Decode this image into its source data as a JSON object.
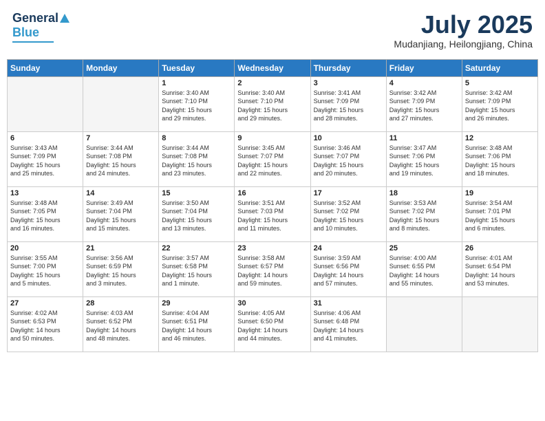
{
  "header": {
    "logo_general": "General",
    "logo_blue": "Blue",
    "month_year": "July 2025",
    "location": "Mudanjiang, Heilongjiang, China"
  },
  "days_of_week": [
    "Sunday",
    "Monday",
    "Tuesday",
    "Wednesday",
    "Thursday",
    "Friday",
    "Saturday"
  ],
  "weeks": [
    [
      {
        "day": "",
        "info": ""
      },
      {
        "day": "",
        "info": ""
      },
      {
        "day": "1",
        "info": "Sunrise: 3:40 AM\nSunset: 7:10 PM\nDaylight: 15 hours\nand 29 minutes."
      },
      {
        "day": "2",
        "info": "Sunrise: 3:40 AM\nSunset: 7:10 PM\nDaylight: 15 hours\nand 29 minutes."
      },
      {
        "day": "3",
        "info": "Sunrise: 3:41 AM\nSunset: 7:09 PM\nDaylight: 15 hours\nand 28 minutes."
      },
      {
        "day": "4",
        "info": "Sunrise: 3:42 AM\nSunset: 7:09 PM\nDaylight: 15 hours\nand 27 minutes."
      },
      {
        "day": "5",
        "info": "Sunrise: 3:42 AM\nSunset: 7:09 PM\nDaylight: 15 hours\nand 26 minutes."
      }
    ],
    [
      {
        "day": "6",
        "info": "Sunrise: 3:43 AM\nSunset: 7:09 PM\nDaylight: 15 hours\nand 25 minutes."
      },
      {
        "day": "7",
        "info": "Sunrise: 3:44 AM\nSunset: 7:08 PM\nDaylight: 15 hours\nand 24 minutes."
      },
      {
        "day": "8",
        "info": "Sunrise: 3:44 AM\nSunset: 7:08 PM\nDaylight: 15 hours\nand 23 minutes."
      },
      {
        "day": "9",
        "info": "Sunrise: 3:45 AM\nSunset: 7:07 PM\nDaylight: 15 hours\nand 22 minutes."
      },
      {
        "day": "10",
        "info": "Sunrise: 3:46 AM\nSunset: 7:07 PM\nDaylight: 15 hours\nand 20 minutes."
      },
      {
        "day": "11",
        "info": "Sunrise: 3:47 AM\nSunset: 7:06 PM\nDaylight: 15 hours\nand 19 minutes."
      },
      {
        "day": "12",
        "info": "Sunrise: 3:48 AM\nSunset: 7:06 PM\nDaylight: 15 hours\nand 18 minutes."
      }
    ],
    [
      {
        "day": "13",
        "info": "Sunrise: 3:48 AM\nSunset: 7:05 PM\nDaylight: 15 hours\nand 16 minutes."
      },
      {
        "day": "14",
        "info": "Sunrise: 3:49 AM\nSunset: 7:04 PM\nDaylight: 15 hours\nand 15 minutes."
      },
      {
        "day": "15",
        "info": "Sunrise: 3:50 AM\nSunset: 7:04 PM\nDaylight: 15 hours\nand 13 minutes."
      },
      {
        "day": "16",
        "info": "Sunrise: 3:51 AM\nSunset: 7:03 PM\nDaylight: 15 hours\nand 11 minutes."
      },
      {
        "day": "17",
        "info": "Sunrise: 3:52 AM\nSunset: 7:02 PM\nDaylight: 15 hours\nand 10 minutes."
      },
      {
        "day": "18",
        "info": "Sunrise: 3:53 AM\nSunset: 7:02 PM\nDaylight: 15 hours\nand 8 minutes."
      },
      {
        "day": "19",
        "info": "Sunrise: 3:54 AM\nSunset: 7:01 PM\nDaylight: 15 hours\nand 6 minutes."
      }
    ],
    [
      {
        "day": "20",
        "info": "Sunrise: 3:55 AM\nSunset: 7:00 PM\nDaylight: 15 hours\nand 5 minutes."
      },
      {
        "day": "21",
        "info": "Sunrise: 3:56 AM\nSunset: 6:59 PM\nDaylight: 15 hours\nand 3 minutes."
      },
      {
        "day": "22",
        "info": "Sunrise: 3:57 AM\nSunset: 6:58 PM\nDaylight: 15 hours\nand 1 minute."
      },
      {
        "day": "23",
        "info": "Sunrise: 3:58 AM\nSunset: 6:57 PM\nDaylight: 14 hours\nand 59 minutes."
      },
      {
        "day": "24",
        "info": "Sunrise: 3:59 AM\nSunset: 6:56 PM\nDaylight: 14 hours\nand 57 minutes."
      },
      {
        "day": "25",
        "info": "Sunrise: 4:00 AM\nSunset: 6:55 PM\nDaylight: 14 hours\nand 55 minutes."
      },
      {
        "day": "26",
        "info": "Sunrise: 4:01 AM\nSunset: 6:54 PM\nDaylight: 14 hours\nand 53 minutes."
      }
    ],
    [
      {
        "day": "27",
        "info": "Sunrise: 4:02 AM\nSunset: 6:53 PM\nDaylight: 14 hours\nand 50 minutes."
      },
      {
        "day": "28",
        "info": "Sunrise: 4:03 AM\nSunset: 6:52 PM\nDaylight: 14 hours\nand 48 minutes."
      },
      {
        "day": "29",
        "info": "Sunrise: 4:04 AM\nSunset: 6:51 PM\nDaylight: 14 hours\nand 46 minutes."
      },
      {
        "day": "30",
        "info": "Sunrise: 4:05 AM\nSunset: 6:50 PM\nDaylight: 14 hours\nand 44 minutes."
      },
      {
        "day": "31",
        "info": "Sunrise: 4:06 AM\nSunset: 6:48 PM\nDaylight: 14 hours\nand 41 minutes."
      },
      {
        "day": "",
        "info": ""
      },
      {
        "day": "",
        "info": ""
      }
    ]
  ]
}
